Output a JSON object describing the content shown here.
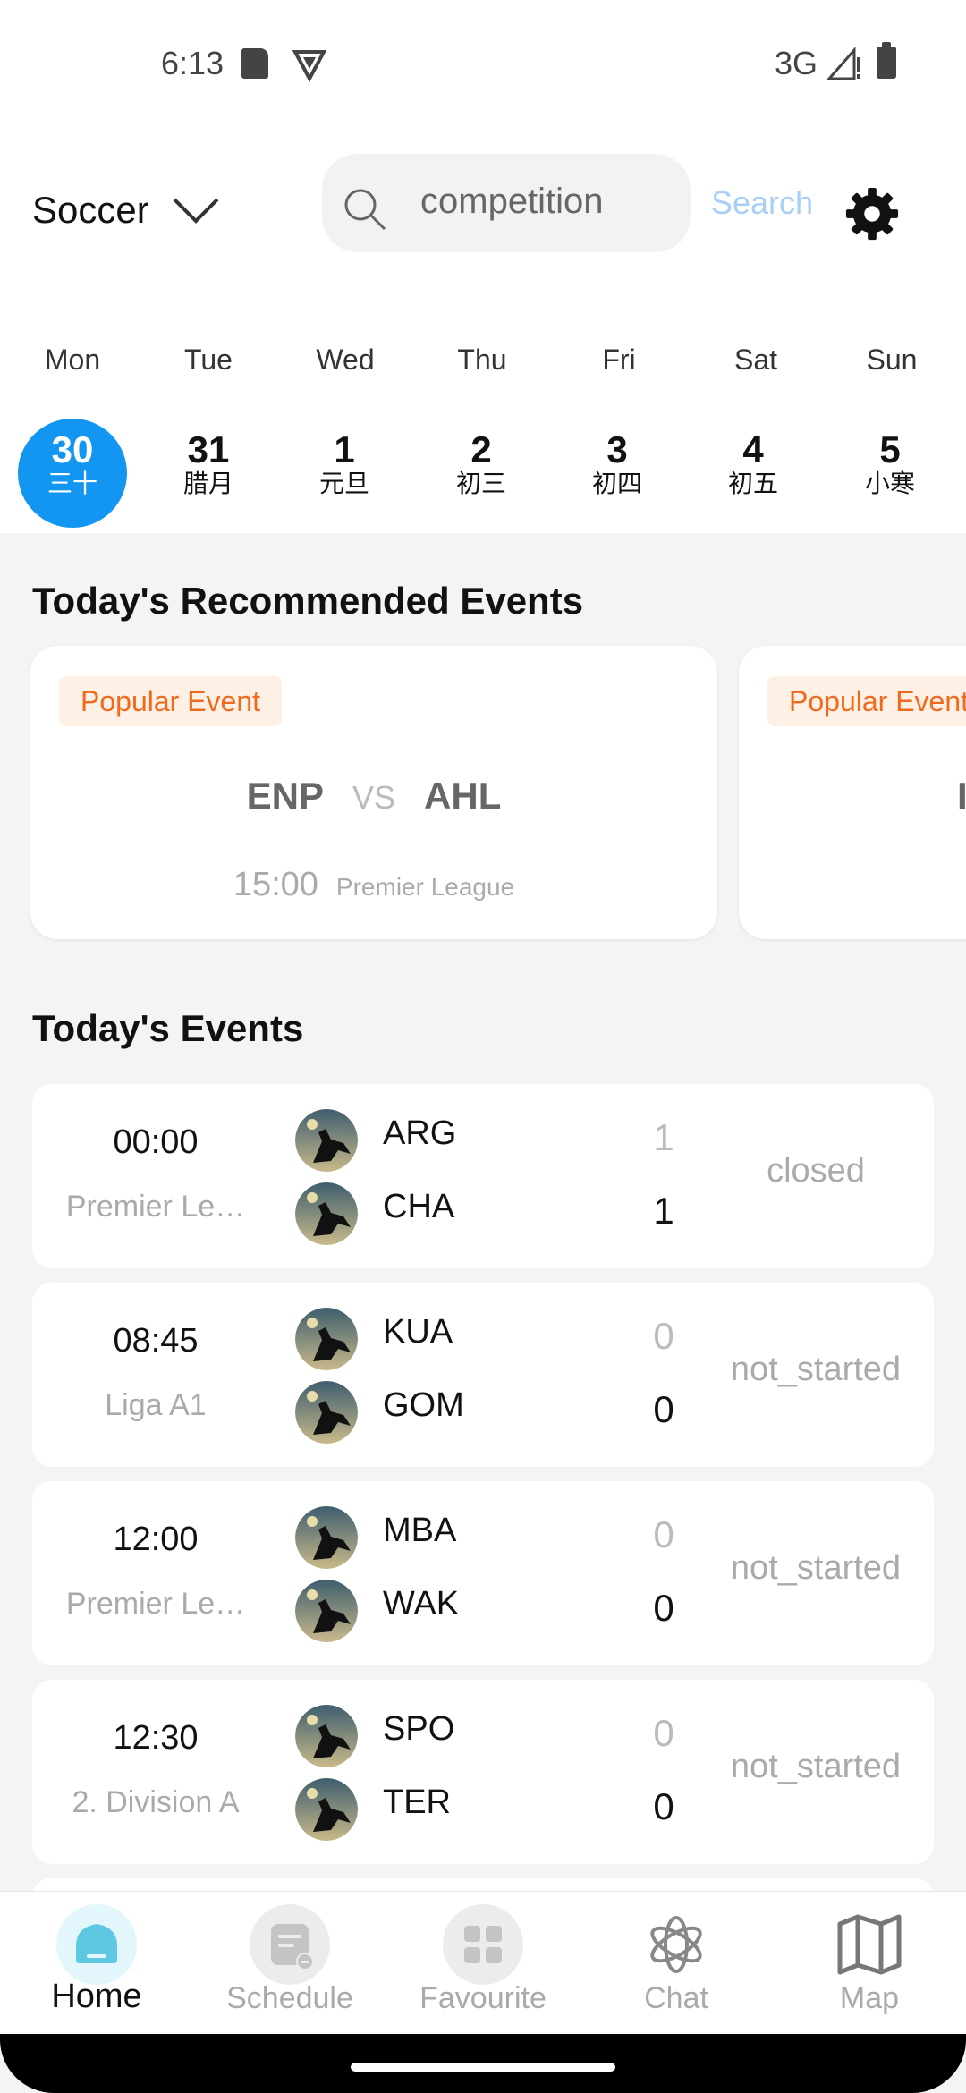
{
  "status_bar": {
    "time": "6:13",
    "network": "3G"
  },
  "header": {
    "sport": "Soccer",
    "search": {
      "placeholder": "competition"
    },
    "search_button": "Search"
  },
  "week": {
    "day_names": [
      "Mon",
      "Tue",
      "Wed",
      "Thu",
      "Fri",
      "Sat",
      "Sun"
    ],
    "days": [
      {
        "num": "30",
        "lunar": "三十",
        "selected": true
      },
      {
        "num": "31",
        "lunar": "腊月"
      },
      {
        "num": "1",
        "lunar": "元旦"
      },
      {
        "num": "2",
        "lunar": "初三"
      },
      {
        "num": "3",
        "lunar": "初四"
      },
      {
        "num": "4",
        "lunar": "初五"
      },
      {
        "num": "5",
        "lunar": "小寒"
      }
    ]
  },
  "recommended": {
    "title": "Today's Recommended Events",
    "cards": [
      {
        "badge": "Popular Event",
        "home": "ENP",
        "vs": "VS",
        "away": "AHL",
        "time": "15:00",
        "league": "Premier League"
      },
      {
        "badge": "Popular Event",
        "home": "I"
      }
    ]
  },
  "events": {
    "title": "Today's Events",
    "items": [
      {
        "time": "00:00",
        "league": "Premier Le…",
        "home": "ARG",
        "away": "CHA",
        "home_score": "1",
        "away_score": "1",
        "status": "closed"
      },
      {
        "time": "08:45",
        "league": "Liga A1",
        "home": "KUA",
        "away": "GOM",
        "home_score": "0",
        "away_score": "0",
        "status": "not_started"
      },
      {
        "time": "12:00",
        "league": "Premier Le…",
        "home": "MBA",
        "away": "WAK",
        "home_score": "0",
        "away_score": "0",
        "status": "not_started"
      },
      {
        "time": "12:30",
        "league": "2. Division A",
        "home": "SPO",
        "away": "TER",
        "home_score": "0",
        "away_score": "0",
        "status": "not_started"
      }
    ]
  },
  "nav": {
    "items": [
      {
        "label": "Home",
        "icon": "home-icon",
        "active": true
      },
      {
        "label": "Schedule",
        "icon": "schedule-icon"
      },
      {
        "label": "Favourite",
        "icon": "favourite-icon"
      },
      {
        "label": "Chat",
        "icon": "chat-icon"
      },
      {
        "label": "Map",
        "icon": "map-icon"
      }
    ]
  },
  "colors": {
    "accent": "#1296f1",
    "badge_text": "#f06a1d",
    "badge_bg": "#fff0e6",
    "home_icon": "#5ec8e3"
  }
}
